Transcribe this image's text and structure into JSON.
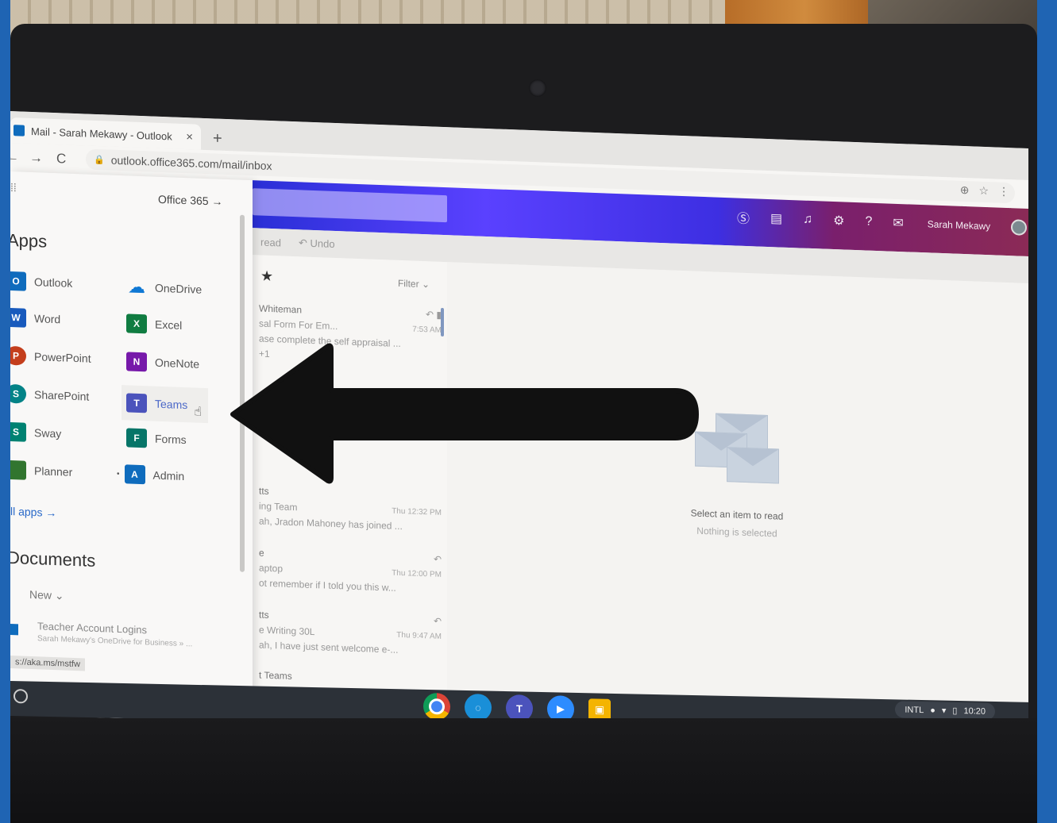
{
  "browser": {
    "tab_title": "Mail - Sarah Mekawy - Outlook",
    "tab_close": "×",
    "new_tab": "+",
    "back": "←",
    "forward": "→",
    "reload": "C",
    "url": "outlook.office365.com/mail/inbox",
    "window_controls": "– ▫ ×"
  },
  "header": {
    "user_name": "Sarah Mekawy",
    "help": "?"
  },
  "command_bar": {
    "read": "read",
    "undo": "Undo"
  },
  "message_list": {
    "filter": "Filter",
    "messages": [
      {
        "sender": "Whiteman",
        "subject": "sal Form For Em...",
        "preview": "ase complete the self appraisal ...",
        "time": "7:53 AM",
        "extra": "+1"
      },
      {
        "sender": "tts",
        "subject": "ing Team",
        "preview": "ah, Jradon Mahoney has joined ...",
        "time": "Thu 12:32 PM"
      },
      {
        "sender": "e",
        "subject": "aptop",
        "preview": "ot remember if I told you this w...",
        "time": "Thu 12:00 PM"
      },
      {
        "sender": "tts",
        "subject": "e Writing 30L",
        "preview": "ah, I have just sent welcome e-...",
        "time": "Thu 9:47 AM"
      },
      {
        "sender": "t Teams",
        "subject": "",
        "preview": "",
        "time": ""
      }
    ]
  },
  "reading_pane": {
    "title": "Select an item to read",
    "subtitle": "Nothing is selected"
  },
  "launcher": {
    "office365_link": "Office 365",
    "apps_heading": "Apps",
    "apps": [
      {
        "label": "Outlook",
        "icon": "O",
        "color": "#0f6cbd"
      },
      {
        "label": "OneDrive",
        "icon": "",
        "color": "#0f78d4"
      },
      {
        "label": "Word",
        "icon": "W",
        "color": "#185abd"
      },
      {
        "label": "Excel",
        "icon": "X",
        "color": "#107c41"
      },
      {
        "label": "PowerPoint",
        "icon": "P",
        "color": "#c43e1c"
      },
      {
        "label": "OneNote",
        "icon": "N",
        "color": "#7719aa"
      },
      {
        "label": "SharePoint",
        "icon": "S",
        "color": "#038387"
      },
      {
        "label": "Teams",
        "icon": "T",
        "color": "#4b53bc"
      },
      {
        "label": "Sway",
        "icon": "S",
        "color": "#008272"
      },
      {
        "label": "Forms",
        "icon": "F",
        "color": "#077568"
      },
      {
        "label": "Planner",
        "icon": "",
        "color": "#31752f"
      },
      {
        "label": "Admin",
        "icon": "A",
        "color": "#0f6cbd"
      }
    ],
    "all_apps": "ll apps →",
    "documents_heading": "Documents",
    "new_doc": "New ⌄",
    "doc_title": "Teacher Account Logins",
    "doc_path": "Sarah Mekawy's OneDrive for Business » ...",
    "status_url": "s://aka.ms/mstfw"
  },
  "shelf": {
    "tray_text": "INTL",
    "clock": "10:20"
  }
}
